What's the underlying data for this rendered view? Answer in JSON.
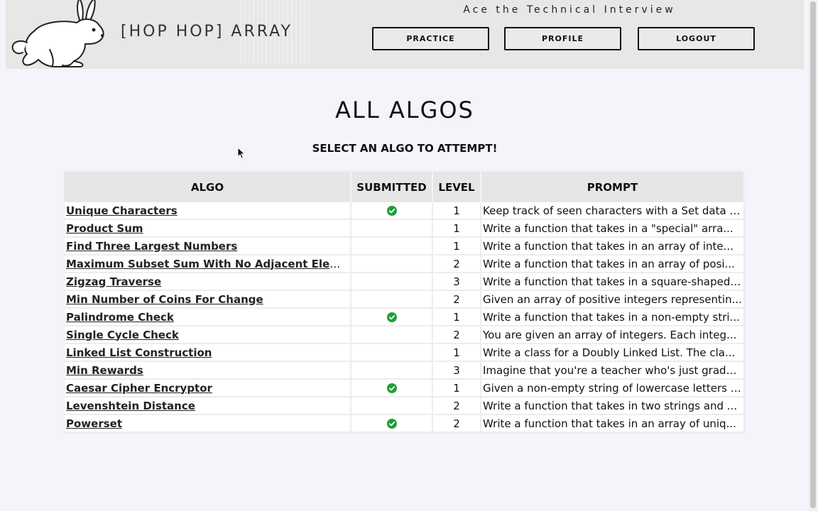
{
  "header": {
    "brand": "[HOP HOP] ARRAY",
    "tagline": "Ace the Technical Interview",
    "nav": {
      "practice": "PRACTICE",
      "profile": "PROFILE",
      "logout": "LOGOUT"
    }
  },
  "main": {
    "title": "ALL ALGOS",
    "subtitle": "SELECT AN ALGO TO ATTEMPT!"
  },
  "table": {
    "headers": {
      "algo": "ALGO",
      "submitted": "SUBMITTED",
      "level": "LEVEL",
      "prompt": "PROMPT"
    },
    "rows": [
      {
        "name": "Unique Characters",
        "submitted": true,
        "level": "1",
        "prompt": "Keep track of seen characters with a Set data s..."
      },
      {
        "name": "Product Sum",
        "submitted": false,
        "level": "1",
        "prompt": "Write a function that takes in a \"special\" arra..."
      },
      {
        "name": "Find Three Largest Numbers",
        "submitted": false,
        "level": "1",
        "prompt": "Write a function that takes in an array of inte..."
      },
      {
        "name": "Maximum Subset Sum With No Adjacent Elements",
        "submitted": false,
        "level": "2",
        "prompt": "Write a function that takes in an array of posi..."
      },
      {
        "name": "Zigzag Traverse",
        "submitted": false,
        "level": "3",
        "prompt": "Write a function that takes in a square-shaped(..."
      },
      {
        "name": "Min Number of Coins For Change",
        "submitted": false,
        "level": "2",
        "prompt": "Given an array of positive integers representin..."
      },
      {
        "name": "Palindrome Check",
        "submitted": true,
        "level": "1",
        "prompt": "Write a function that takes in a non-empty stri..."
      },
      {
        "name": "Single Cycle Check",
        "submitted": false,
        "level": "2",
        "prompt": "You are given an array of integers. Each integ..."
      },
      {
        "name": "Linked List Construction",
        "submitted": false,
        "level": "1",
        "prompt": "Write a class for a Doubly Linked List. The cla..."
      },
      {
        "name": "Min Rewards",
        "submitted": false,
        "level": "3",
        "prompt": "Imagine that you're a teacher who's just graded..."
      },
      {
        "name": "Caesar Cipher Encryptor",
        "submitted": true,
        "level": "1",
        "prompt": "Given a non-empty string of lowercase letters a..."
      },
      {
        "name": "Levenshtein Distance",
        "submitted": false,
        "level": "2",
        "prompt": "Write a function that takes in two strings and ..."
      },
      {
        "name": "Powerset",
        "submitted": true,
        "level": "2",
        "prompt": "Write a function that takes in an array of uniq..."
      }
    ]
  },
  "icons": {
    "logo": "rabbit-icon",
    "submitted": "check-circle-icon",
    "cursor": "mouse-pointer-icon"
  },
  "colors": {
    "check": "#1e9e3a",
    "header_bg": "#e7e7e6",
    "page_bg": "#f4f4fa"
  }
}
